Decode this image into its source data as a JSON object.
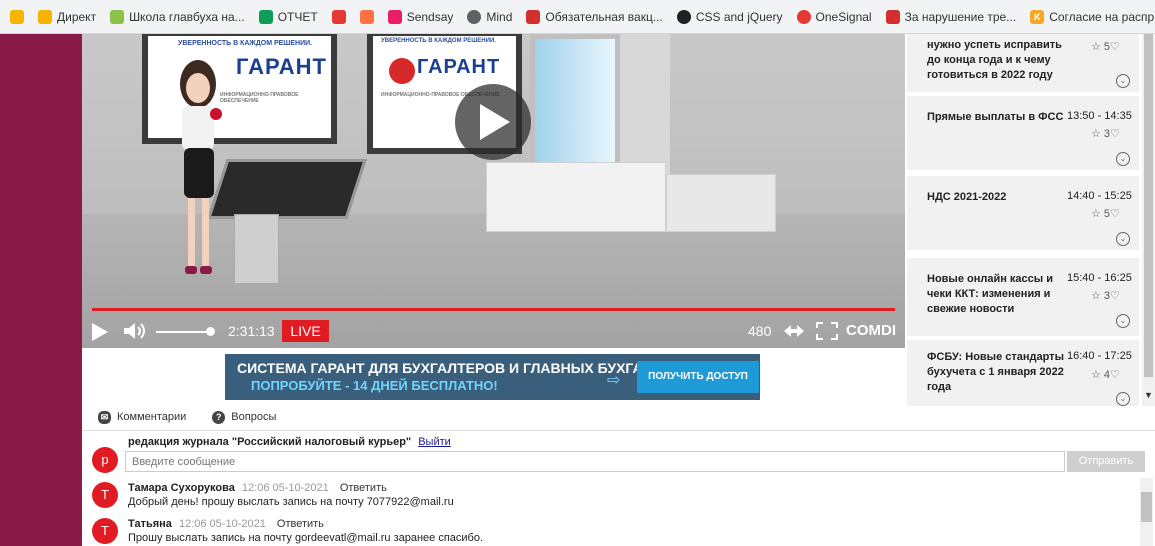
{
  "bookmarks": [
    {
      "label": "",
      "icon": "bar-chart-icon",
      "color": "#f4b400"
    },
    {
      "label": "Директ",
      "icon": "direct-icon",
      "color": "#f4b400"
    },
    {
      "label": "Школа главбуха на...",
      "icon": "school-icon",
      "color": "#8bc34a"
    },
    {
      "label": "ОТЧЕТ",
      "icon": "sheet-icon",
      "color": "#0f9d58"
    },
    {
      "label": "",
      "icon": "analytics-icon",
      "color": "#e53935"
    },
    {
      "label": "",
      "icon": "magnet-icon",
      "color": "#ff7043"
    },
    {
      "label": "Sendsay",
      "icon": "sendsay-icon",
      "color": "#e91e63"
    },
    {
      "label": "Mind",
      "icon": "mind-icon",
      "color": "#616161"
    },
    {
      "label": "Обязательная вакц...",
      "icon": "garant-icon",
      "color": "#d32f2f"
    },
    {
      "label": "CSS and jQuery",
      "icon": "github-icon",
      "color": "#212121"
    },
    {
      "label": "OneSignal",
      "icon": "onesignal-icon",
      "color": "#e53935"
    },
    {
      "label": "За нарушение тре...",
      "icon": "garant-icon",
      "color": "#d32f2f"
    },
    {
      "label": "Согласие на распр...",
      "icon": "k-icon",
      "color": "#f9a825"
    },
    {
      "label": "",
      "icon": "mind-icon",
      "color": "#616161"
    }
  ],
  "video": {
    "brand_text": "ГАРАНТ",
    "brand_tag_1": "УВЕРЕННОСТЬ В КАЖДОМ РЕШЕНИИ.",
    "brand_tag_2": "УВЕРЕННОСТЬ В КАЖДОМ РЕШЕНИИ.",
    "brand_sub": "ИНФОРМАЦИОННО-ПРАВОВОЕ ОБЕСПЕЧЕНИЕ",
    "time": "2:31:13",
    "live_label": "LIVE",
    "quality": "480",
    "logo": "COMDI",
    "progress_fraction": 1.0,
    "volume_fraction": 0.85,
    "accent_color": "#e11b22"
  },
  "schedule": [
    {
      "title": "нужно успеть исправить до конца года и к чему готовиться в 2022 году",
      "time": "",
      "rating": "5"
    },
    {
      "title": "Прямые выплаты в ФСС",
      "time": "13:50 - 14:35",
      "rating": "3"
    },
    {
      "title": "НДС 2021-2022",
      "time": "14:40 - 15:25",
      "rating": "5"
    },
    {
      "title": "Новые онлайн кассы и чеки ККТ: изменения и свежие новости",
      "time": "15:40 - 16:25",
      "rating": "3"
    },
    {
      "title": "ФСБУ: Новые стандарты бухучета с 1 января 2022 года",
      "time": "16:40 - 17:25",
      "rating": "4"
    }
  ],
  "banner": {
    "line1": "СИСТЕМА ГАРАНТ ДЛЯ БУХГАЛТЕРОВ И ГЛАВНЫХ БУХГАЛТЕРОВ",
    "line2": "ПОПРОБУЙТЕ - 14 ДНЕЙ БЕСПЛАТНО!",
    "button": "ПОЛУЧИТЬ ДОСТУП"
  },
  "tabs": [
    {
      "label": "Комментарии"
    },
    {
      "label": "Вопросы"
    }
  ],
  "current_user": {
    "name": "редакция журнала \"Российский налоговый курьер\"",
    "logout": "Выйти",
    "avatar_letter": "р"
  },
  "composer": {
    "placeholder": "Введите сообщение",
    "send": "Отправить"
  },
  "comments": [
    {
      "author": "Тамара Сухорукова",
      "date": "12:06 05-10-2021",
      "reply": "Ответить",
      "text": "Добрый день! прошу выслать запись на почту 7077922@mail.ru",
      "avatar_letter": "Т"
    },
    {
      "author": "Татьяна",
      "date": "12:06 05-10-2021",
      "reply": "Ответить",
      "text": "Прошу выслать запись на почту gordeevatl@mail.ru заранее спасибо.",
      "avatar_letter": "Т"
    }
  ]
}
